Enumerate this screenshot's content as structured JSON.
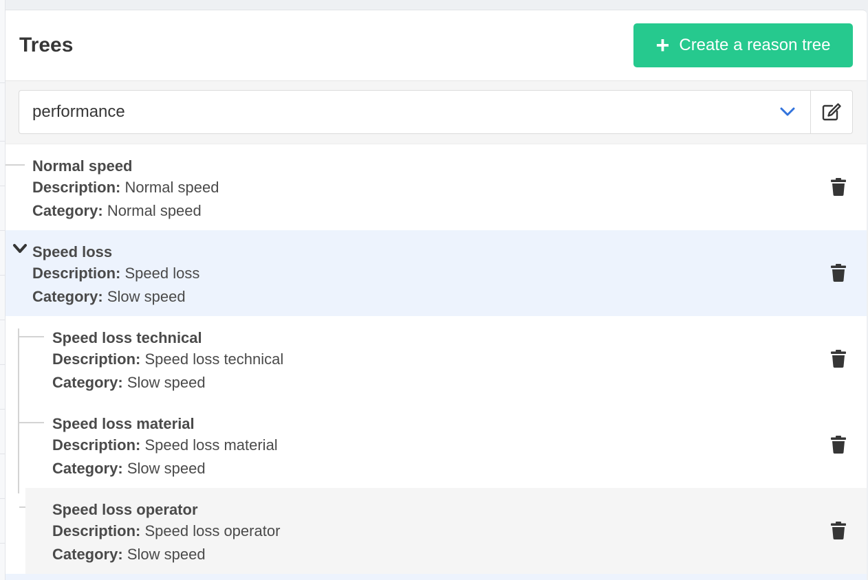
{
  "header": {
    "title": "Trees",
    "create_button_label": "Create a reason tree"
  },
  "tree_select": {
    "selected": "performance"
  },
  "labels": {
    "description": "Description:",
    "category": "Category:"
  },
  "nodes": [
    {
      "name": "Normal speed",
      "description": "Normal speed",
      "category": "Normal speed"
    },
    {
      "name": "Speed loss",
      "description": "Speed loss",
      "category": "Slow speed"
    },
    {
      "name": "Speed loss technical",
      "description": "Speed loss technical",
      "category": "Slow speed"
    },
    {
      "name": "Speed loss material",
      "description": "Speed loss material",
      "category": "Slow speed"
    },
    {
      "name": "Speed loss operator",
      "description": "Speed loss operator",
      "category": "Slow speed"
    }
  ],
  "colors": {
    "accent": "#26c98e",
    "selected_row": "#edf3fd",
    "chevron": "#3273dc"
  },
  "icons": [
    "plus-icon",
    "chevron-down-icon",
    "edit-icon",
    "trash-icon",
    "collapse-chevron-icon"
  ]
}
